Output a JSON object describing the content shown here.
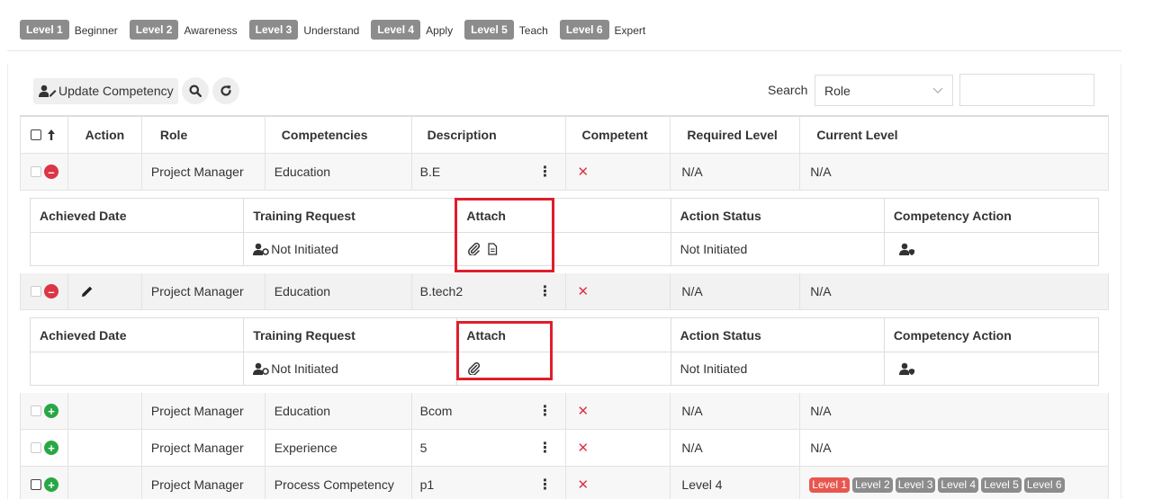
{
  "legend": [
    {
      "badge": "Level 1",
      "text": "Beginner"
    },
    {
      "badge": "Level 2",
      "text": "Awareness"
    },
    {
      "badge": "Level 3",
      "text": "Understand"
    },
    {
      "badge": "Level 4",
      "text": "Apply"
    },
    {
      "badge": "Level 5",
      "text": "Teach"
    },
    {
      "badge": "Level 6",
      "text": "Expert"
    }
  ],
  "toolbar": {
    "update_label": "Update Competency",
    "search_label": "Search",
    "search_scope": "Role",
    "search_value": ""
  },
  "table": {
    "headers": [
      "Action",
      "Role",
      "Competencies",
      "Description",
      "Competent",
      "Required Level",
      "Current Level"
    ],
    "rows": [
      {
        "role": "Project Manager",
        "competency": "Education",
        "description": "B.E",
        "competent": "✕",
        "required": "N/A",
        "current": "N/A",
        "expanded": true
      },
      {
        "role": "Project Manager",
        "competency": "Education",
        "description": "B.tech2",
        "competent": "✕",
        "required": "N/A",
        "current": "N/A",
        "expanded": true
      },
      {
        "role": "Project Manager",
        "competency": "Education",
        "description": "Bcom",
        "competent": "✕",
        "required": "N/A",
        "current": "N/A",
        "expanded": false
      },
      {
        "role": "Project Manager",
        "competency": "Experience",
        "description": "5",
        "competent": "✕",
        "required": "N/A",
        "current": "N/A",
        "expanded": false
      },
      {
        "role": "Project Manager",
        "competency": "Process Competency",
        "description": "p1",
        "competent": "✕",
        "required": "Level 4",
        "current": "",
        "expanded": false
      }
    ],
    "current_levels_last_row": [
      "Level 1",
      "Level 2",
      "Level 3",
      "Level 4",
      "Level 5",
      "Level 6"
    ]
  },
  "details": {
    "headers": [
      "Achieved Date",
      "Training Request",
      "Attach",
      "Action Status",
      "Competency Action"
    ],
    "rows": [
      {
        "achieved_date": "",
        "training_request": "Not Initiated",
        "action_status": "Not Initiated"
      },
      {
        "achieved_date": "",
        "training_request": "Not Initiated",
        "action_status": "Not Initiated"
      }
    ]
  },
  "colors": {
    "highlight": "#e01e2b",
    "danger": "#dc3545",
    "success": "#28a745",
    "badge": "#8c8c8c",
    "active_level": "#e8574f"
  },
  "icons": [
    "user-edit-icon",
    "search-icon",
    "refresh-icon",
    "chevron-down-icon",
    "sort-up-arrow-icon",
    "collapse-icon",
    "expand-icon",
    "pencil-icon",
    "kebab-menu-icon",
    "close-x-icon",
    "user-cog-icon",
    "paperclip-icon",
    "document-icon",
    "user-shield-icon"
  ]
}
